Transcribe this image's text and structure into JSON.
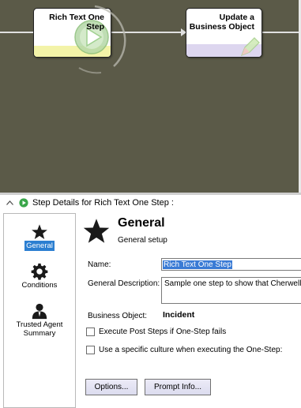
{
  "workflow": {
    "nodes": [
      {
        "line1": "Rich Text One",
        "line2": "Step"
      },
      {
        "line1": "Update a",
        "line2": "Business Object"
      }
    ]
  },
  "details": {
    "header_title": "Step Details for Rich Text One Step :"
  },
  "sidebar": {
    "items": [
      {
        "label": "General",
        "icon": "star-icon",
        "selected": true
      },
      {
        "label": "Conditions",
        "icon": "gear-icon",
        "selected": false
      },
      {
        "label": "Trusted Agent Summary",
        "icon": "agent-icon",
        "selected": false
      }
    ]
  },
  "general": {
    "title": "General",
    "subtitle": "General setup",
    "name_label": "Name:",
    "name_value": "Rich Text One Step",
    "description_label": "General Description:",
    "description_value": "Sample one step to show that Cherwell one",
    "business_object_label": "Business Object:",
    "business_object_value": "Incident",
    "execute_post_steps_label": "Execute Post Steps if One-Step fails",
    "use_culture_label": "Use a specific culture when executing the One-Step:",
    "options_button": "Options...",
    "prompt_info_button": "Prompt Info..."
  },
  "colors": {
    "canvas": "#5b5a48",
    "accent": "#2c7fd1",
    "node1_stripe": "#f3f3a8",
    "node2_stripe": "#ddd6ef"
  }
}
